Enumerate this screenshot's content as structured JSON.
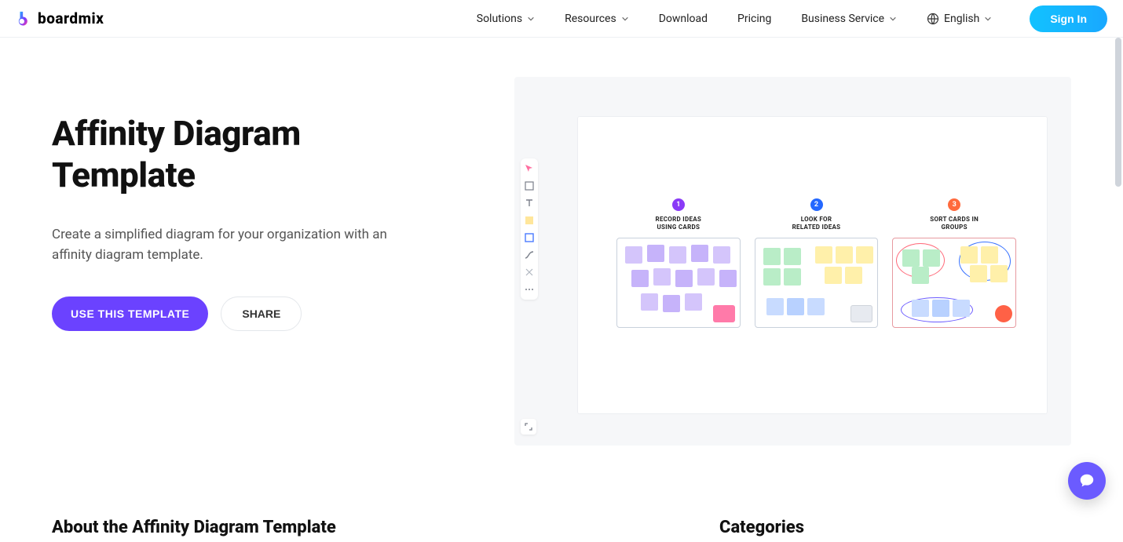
{
  "brand": {
    "name": "boardmix"
  },
  "nav": {
    "items": [
      {
        "label": "Solutions",
        "hasDropdown": true
      },
      {
        "label": "Resources",
        "hasDropdown": true
      },
      {
        "label": "Download",
        "hasDropdown": false
      },
      {
        "label": "Pricing",
        "hasDropdown": false
      },
      {
        "label": "Business Service",
        "hasDropdown": true
      }
    ],
    "language": "English",
    "signin": "Sign In"
  },
  "hero": {
    "title": "Affinity Diagram Template",
    "subtitle": "Create a simplified diagram for your organization with an affinity diagram template.",
    "primary_cta": "USE THIS TEMPLATE",
    "secondary_cta": "SHARE"
  },
  "preview": {
    "steps": [
      {
        "num": "1",
        "line1": "RECORD IDEAS",
        "line2": "USING CARDS"
      },
      {
        "num": "2",
        "line1": "LOOK FOR",
        "line2": "RELATED IDEAS"
      },
      {
        "num": "3",
        "line1": "SORT CARDS IN",
        "line2": "GROUPS"
      }
    ]
  },
  "sections": {
    "about": "About the Affinity Diagram Template",
    "categories": "Categories"
  }
}
